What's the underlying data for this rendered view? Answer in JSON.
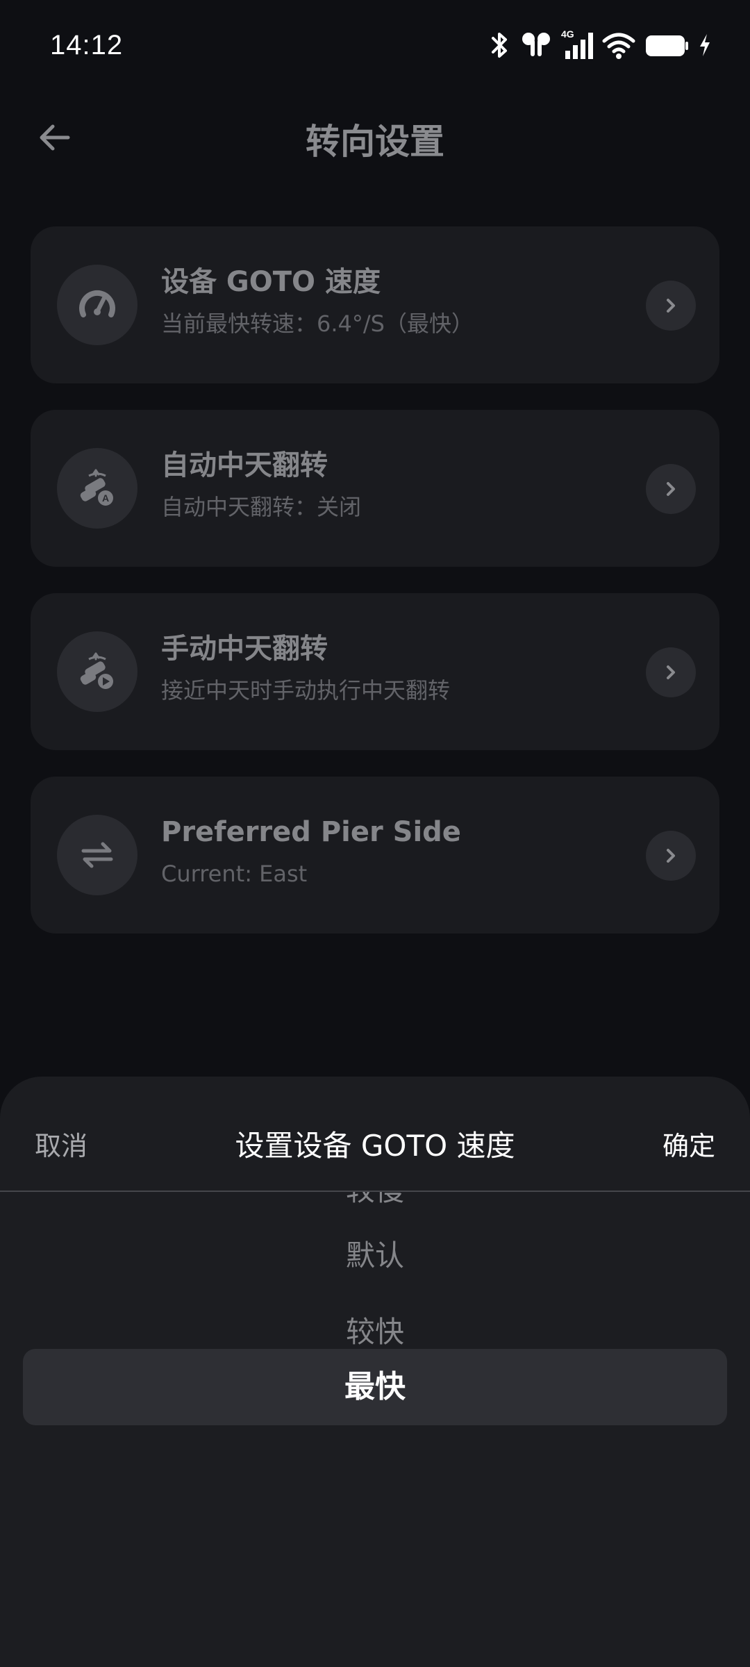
{
  "status_bar": {
    "time": "14:12",
    "network": "4G",
    "icons": [
      "bluetooth-icon",
      "earbuds-icon",
      "signal-icon",
      "wifi-icon",
      "battery-icon",
      "charging-icon"
    ]
  },
  "header": {
    "title": "转向设置",
    "back_icon": "arrow-left-icon"
  },
  "settings": [
    {
      "title": "设备 GOTO 速度",
      "subtitle": "当前最快转速：6.4°/S（最快）",
      "icon": "speedometer-icon"
    },
    {
      "title": "自动中天翻转",
      "subtitle": "自动中天翻转：关闭",
      "icon": "telescope-auto-icon"
    },
    {
      "title": "手动中天翻转",
      "subtitle": "接近中天时手动执行中天翻转",
      "icon": "telescope-manual-icon"
    },
    {
      "title": "Preferred Pier Side",
      "subtitle": "Current: East",
      "icon": "swap-arrows-icon"
    }
  ],
  "sheet": {
    "cancel_label": "取消",
    "title": "设置设备 GOTO 速度",
    "confirm_label": "确定",
    "options": [
      "较慢",
      "默认",
      "较快",
      "最快"
    ],
    "selected": "最快"
  },
  "colors": {
    "background": "#0e0f13",
    "card": "#1a1b1f",
    "sheet": "#1c1d21",
    "selected_row": "#2e2f34"
  }
}
